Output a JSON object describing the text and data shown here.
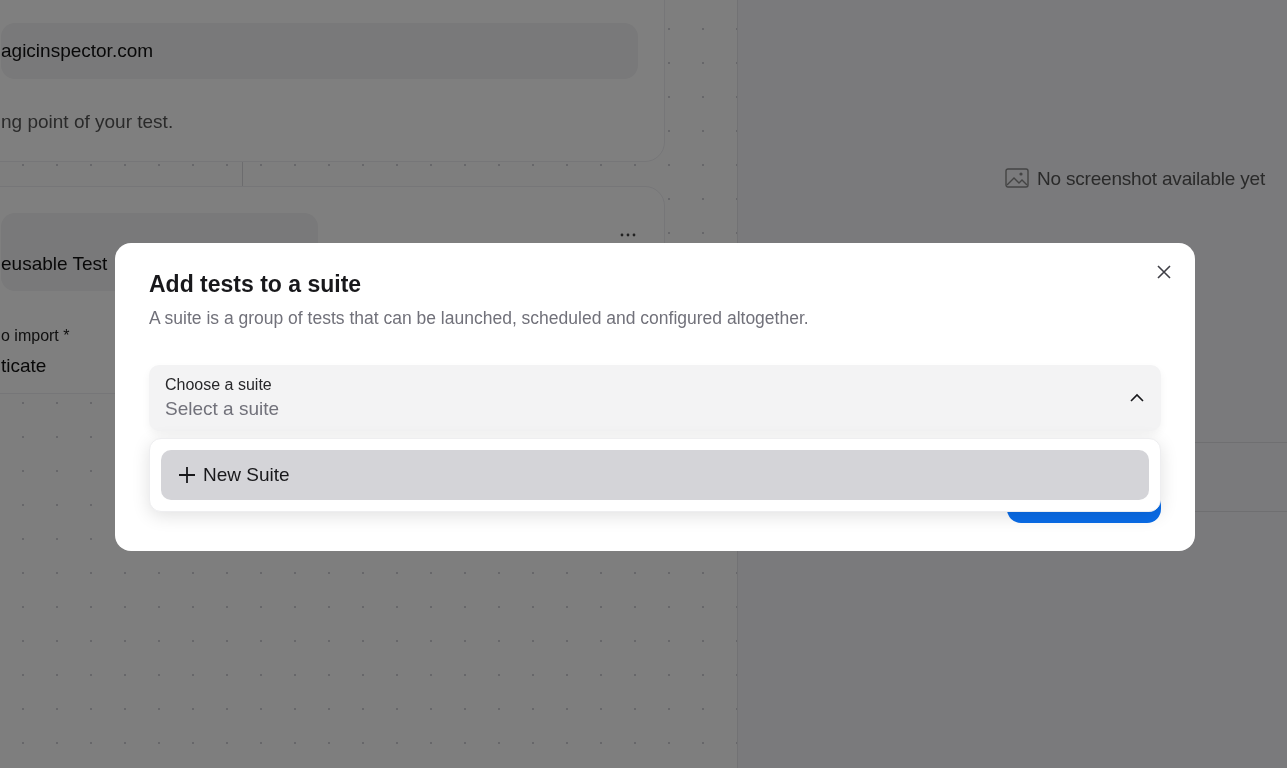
{
  "background": {
    "url_field": "agicinspector.com",
    "hint": "ng point of your test.",
    "step_field": "eusable Test",
    "import_label": "o import",
    "required_mark": "*",
    "import_value": "ticate"
  },
  "preview": {
    "empty_text": "No screenshot available yet"
  },
  "dialog": {
    "title": "Add tests to a suite",
    "description": "A suite is a group of tests that can be launched, scheduled and configured altogether.",
    "select": {
      "label": "Choose a suite",
      "placeholder": "Select a suite",
      "expanded": true
    },
    "options": [
      {
        "label": "New Suite",
        "kind": "create",
        "selected": true
      }
    ]
  }
}
